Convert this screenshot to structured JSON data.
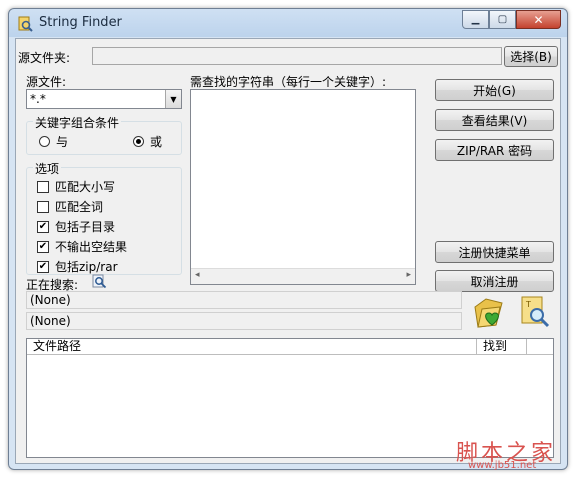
{
  "window": {
    "title": "String Finder"
  },
  "source_folder": {
    "label": "源文件夹:",
    "value": "",
    "browse_label": "选择(B)"
  },
  "source_file": {
    "label": "源文件:",
    "value": "*.*"
  },
  "keyword_condition": {
    "title": "关键字组合条件",
    "and_label": "与",
    "or_label": "或",
    "selected": "或"
  },
  "options": {
    "title": "选项",
    "items": [
      {
        "label": "匹配大小写",
        "checked": false
      },
      {
        "label": "匹配全词",
        "checked": false
      },
      {
        "label": "包括子目录",
        "checked": true
      },
      {
        "label": "不输出空结果",
        "checked": true
      },
      {
        "label": "包括zip/rar",
        "checked": true
      }
    ]
  },
  "search_strings": {
    "label": "需查找的字符串（每行一个关键字）:",
    "value": ""
  },
  "buttons": {
    "start": "开始(G)",
    "view_results": "查看结果(V)",
    "zip_password": "ZIP/RAR 密码",
    "register_menu": "注册快捷菜单",
    "unregister": "取消注册"
  },
  "searching": {
    "label": "正在搜索:",
    "status1": "(None)",
    "status2": "(None)"
  },
  "results": {
    "columns": [
      "文件路径",
      "找到"
    ],
    "rows": []
  },
  "watermark": {
    "logo": "脚本之家",
    "url": "www.jb51.net"
  }
}
